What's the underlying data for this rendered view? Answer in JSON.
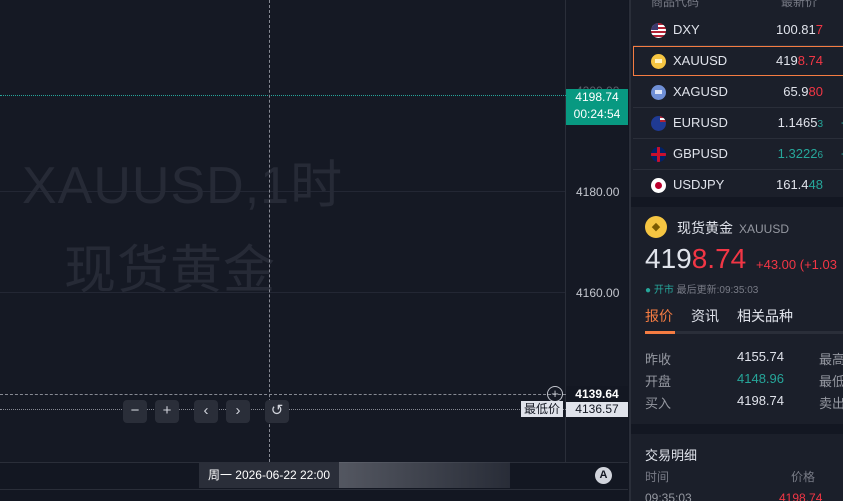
{
  "chart": {
    "watermark_symbol": "XAUUSD,1时",
    "watermark_name": "现货黄金",
    "price_ticks": [
      "4180.00",
      "4160.00"
    ],
    "partial_tick": "4200.00",
    "current_price": "4198.74",
    "countdown": "00:24:54",
    "crosshair_price": "4139.64",
    "low_label": "最低价",
    "low_price": "4136.57",
    "crosshair_time": "周一 2026-06-22  22:00",
    "controls": {
      "zoom_out": "−",
      "zoom_in": "+",
      "prev": "‹",
      "next": "›",
      "reset": "↺"
    },
    "auto_scale": "A",
    "colors": {
      "up": "#089981",
      "down": "#f23645",
      "accent": "#f57c42"
    }
  },
  "watchlist": {
    "header_symbol": "商品代码",
    "header_last": "最新价",
    "rows": [
      {
        "symbol": "DXY",
        "last_main": "100.81",
        "last_hl": "7",
        "hl_color": "red",
        "tail": "",
        "flag": "us-flag-icon"
      },
      {
        "symbol": "XAUUSD",
        "last_main": "419",
        "last_hl": "8.74",
        "hl_color": "red",
        "tail": "",
        "flag": "gold-icon",
        "selected": true
      },
      {
        "symbol": "XAGUSD",
        "last_main": "65.9",
        "last_hl": "80",
        "hl_color": "red",
        "tail": "",
        "flag": "silver-icon"
      },
      {
        "symbol": "EURUSD",
        "last_main": "1.1465",
        "last_hl": "3",
        "hl_color": "green",
        "tail": "-",
        "flag": "eu-flag-icon"
      },
      {
        "symbol": "GBPUSD",
        "last_main": "1.3222",
        "last_hl": "6",
        "hl_color": "green",
        "tail": "-",
        "flag": "uk-flag-icon"
      },
      {
        "symbol": "USDJPY",
        "last_main": "161.4",
        "last_hl": "48",
        "hl_color": "green",
        "tail": "",
        "flag": "jp-flag-icon"
      }
    ]
  },
  "quote": {
    "name": "现货黄金",
    "symbol": "XAUUSD",
    "price_main": "419",
    "price_hl": "8.74",
    "change": "+43.00 (+1.03",
    "status": "开市",
    "updated": "最后更新:09:35:03",
    "tabs": [
      "报价",
      "资讯",
      "相关品种"
    ],
    "stats": [
      {
        "label": "昨收",
        "value": "4155.74",
        "right_label": "最高"
      },
      {
        "label": "开盘",
        "value": "4148.96",
        "right_label": "最低"
      },
      {
        "label": "买入",
        "value": "4198.74",
        "right_label": "卖出"
      }
    ],
    "trades_title": "交易明细",
    "trade_headers": {
      "time": "时间",
      "price": "价格"
    },
    "trade_row": {
      "time": "09:35:03",
      "price": "4198.74"
    }
  }
}
